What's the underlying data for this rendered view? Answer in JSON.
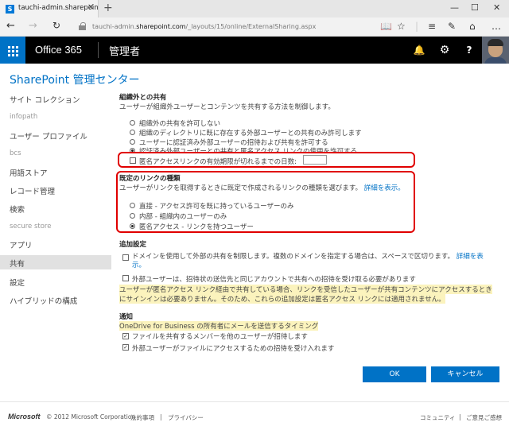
{
  "browser": {
    "tab_title": "tauchi-admin.sharepoin",
    "url_prefix": "tauchi-admin.",
    "url_domain": "sharepoint.com",
    "url_path": "/_layouts/15/online/ExternalSharing.aspx"
  },
  "suitebar": {
    "brand": "Office 365",
    "admin_label": "管理者",
    "help_label": "?"
  },
  "page_header": "SharePoint 管理センター",
  "nav": {
    "items": [
      "サイト コレクション",
      "infopath",
      "ユーザー プロファイル",
      "bcs",
      "用語ストア",
      "レコード管理",
      "検索",
      "secure store",
      "アプリ",
      "共有",
      "設定",
      "ハイブリッドの構成"
    ],
    "active": "共有"
  },
  "external_sharing": {
    "heading": "組織外との共有",
    "description": "ユーザーが組織外ユーザーとコンテンツを共有する方法を制御します。",
    "options": [
      "組織外の共有を許可しない",
      "組織のディレクトリに既に存在する外部ユーザーとの共有のみ許可します",
      "ユーザーに認証済み外部ユーザーの招待および共有を許可する",
      "認証済み外部ユーザーとの共有と匿名アクセス リンクの使用を許可する"
    ],
    "selected_index": 3,
    "expire_label": "匿名アクセスリンクの有効期限が切れるまでの日数:",
    "expire_value": ""
  },
  "default_link": {
    "heading": "既定のリンクの種類",
    "description": "ユーザーがリンクを取得するときに既定で作成されるリンクの種類を選びます。",
    "details_link": "詳細を表示。",
    "options": [
      "直接 - アクセス許可を既に持っているユーザーのみ",
      "内部 - 組織内のユーザーのみ",
      "匿名アクセス - リンクを持つユーザー"
    ],
    "selected_index": 2
  },
  "additional": {
    "heading": "追加設定",
    "domain_text": "ドメインを使用して外部の共有を制限します。複数のドメインを指定する場合は、スペースで区切ります。",
    "domain_link": "詳細を表",
    "domain_link2": "示。",
    "invite_text": "外部ユーザーは、招待状の送信先と同じアカウントで共有への招待を受け取る必要があります",
    "note_line1": "ユーザーが匿名アクセス リンク経由で共有している場合、リンクを受信したユーザーが共有コンテンツにアクセスするとき",
    "note_line2": "にサインインは必要ありません。そのため、これらの追加設定は匿名アクセス リンクには適用されません。"
  },
  "notify": {
    "heading": "通知",
    "subheading": "OneDrive for Business の所有者にメールを送信するタイミング",
    "items": [
      "ファイルを共有するメンバーを他のユーザーが招待します",
      "外部ユーザーがファイルにアクセスするための招待を受け入れます"
    ]
  },
  "buttons": {
    "ok": "OK",
    "cancel": "キャンセル"
  },
  "footer": {
    "logo": "Microsoft",
    "copyright": "© 2012 Microsoft Corporation",
    "legal": "法的事項",
    "sep": "|",
    "privacy": "プライバシー",
    "community": "コミュニティ",
    "feedback": "ご意見ご感想"
  }
}
